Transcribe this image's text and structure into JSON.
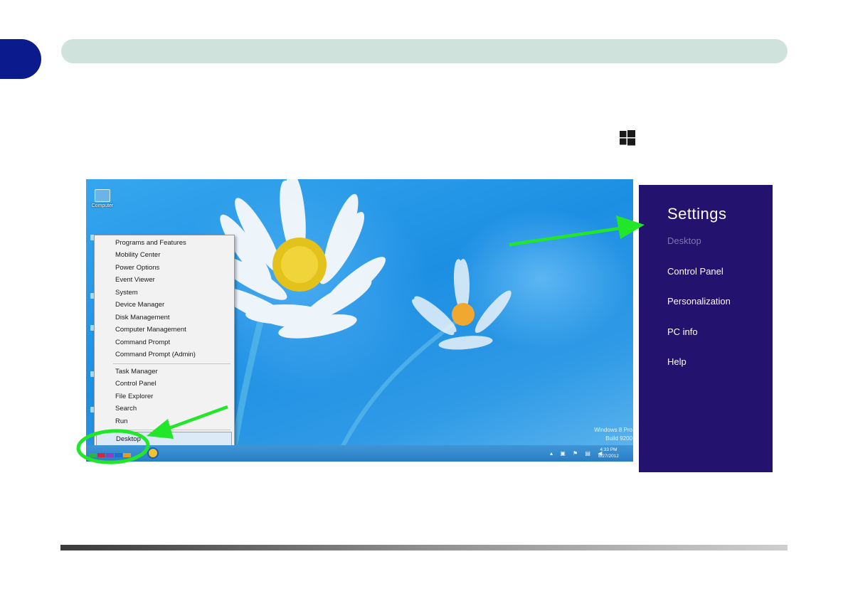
{
  "desktop": {
    "icons": [
      {
        "label": "Computer",
        "icon": "computer-icon"
      }
    ],
    "context_menu": {
      "group1": [
        "Programs and Features",
        "Mobility Center",
        "Power Options",
        "Event Viewer",
        "System",
        "Device Manager",
        "Disk Management",
        "Computer Management",
        "Command Prompt",
        "Command Prompt (Admin)"
      ],
      "group2": [
        "Task Manager",
        "Control Panel",
        "File Explorer",
        "Search",
        "Run"
      ],
      "group3": [
        "Desktop"
      ]
    },
    "watermark": {
      "line1": "Windows 8 Pro",
      "line2": "Build 9200"
    },
    "clock": {
      "time": "4:33 PM",
      "date": "8/27/2012"
    }
  },
  "settings_charm": {
    "title": "Settings",
    "items": [
      "Desktop",
      "Control Panel",
      "Personalization",
      "PC info",
      "Help"
    ]
  },
  "colors": {
    "chapter_tab": "#0b1a8c",
    "header_bar": "#cfe3dc",
    "charm_bg": "#23126e",
    "highlight_green": "#22e62a"
  }
}
